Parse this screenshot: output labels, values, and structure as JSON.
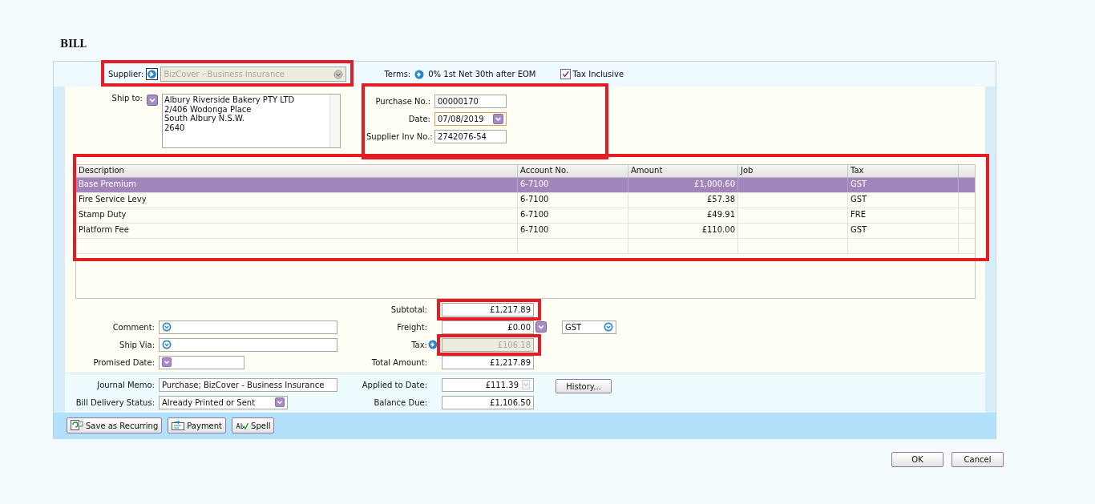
{
  "title": "BILL",
  "supplier": {
    "label": "Supplier:",
    "value": "BizCover - Business Insurance",
    "disabled": true,
    "highlighted": true
  },
  "terms": {
    "label": "Terms:",
    "value": "0% 1st Net 30th after EOM"
  },
  "tax_inclusive": {
    "label": "Tax Inclusive",
    "checked": true
  },
  "ship_to": {
    "label": "Ship to:",
    "lines": [
      "Albury Riverside Bakery PTY LTD",
      "2/406 Wodonga Place",
      "South Albury N.S.W.",
      "2640"
    ]
  },
  "header_fields": {
    "highlighted": true,
    "fields": [
      {
        "label": "Purchase No.:",
        "value": "00000170",
        "kind": "text"
      },
      {
        "label": "Date:",
        "value": "07/08/2019",
        "kind": "date"
      },
      {
        "label": "Supplier Inv No.:",
        "value": "2742076-54",
        "kind": "text"
      }
    ]
  },
  "table": {
    "highlighted": true,
    "columns": [
      "Description",
      "Account No.",
      "Amount",
      "Job",
      "Tax"
    ],
    "rows": [
      {
        "cells": [
          "Base Premium",
          "6-7100",
          "£1,000.60",
          "",
          "GST"
        ],
        "selected": true
      },
      {
        "cells": [
          "Fire Service Levy",
          "6-7100",
          "£57.38",
          "",
          "GST"
        ],
        "selected": false
      },
      {
        "cells": [
          "Stamp Duty",
          "6-7100",
          "£49.91",
          "",
          "FRE"
        ],
        "selected": false
      },
      {
        "cells": [
          "Platform Fee",
          "6-7100",
          "£110.00",
          "",
          "GST"
        ],
        "selected": false
      }
    ]
  },
  "left_fields": [
    {
      "label": "Comment:",
      "kind": "combo"
    },
    {
      "label": "Ship Via:",
      "kind": "combo"
    },
    {
      "label": "Promised Date:",
      "kind": "date"
    }
  ],
  "totals": [
    {
      "label": "Subtotal:",
      "value": "£1,217.89",
      "kind": "plain",
      "disabled": false,
      "highlighted": true
    },
    {
      "label": "Freight:",
      "value": "£0.00",
      "kind": "dropdown",
      "disabled": false,
      "highlighted": false
    },
    {
      "label": "Tax:",
      "value": "£106.18",
      "kind": "link",
      "disabled": true,
      "highlighted": true
    },
    {
      "label": "Total Amount:",
      "value": "£1,217.89",
      "kind": "plain",
      "disabled": false,
      "highlighted": false
    }
  ],
  "freight_tax_code": {
    "value": "GST"
  },
  "memo_fields": [
    {
      "label": "Journal Memo:",
      "value": "Purchase; BizCover - Business Insurance",
      "kind": "text"
    },
    {
      "label": "Bill Delivery Status:",
      "value": "Already Printed or Sent",
      "kind": "dropdown"
    }
  ],
  "payment_fields": [
    {
      "label": "Applied to Date:",
      "value": "£111.39",
      "kind": "dropdown"
    },
    {
      "label": "Balance Due:",
      "value": "£1,106.50",
      "kind": "plain"
    }
  ],
  "history_button": "History...",
  "action_buttons": [
    {
      "label": "Save as Recurring",
      "kind": "recurring"
    },
    {
      "label": "Payment",
      "kind": "payment"
    },
    {
      "label": "Spell",
      "kind": "spell"
    }
  ],
  "dialog_buttons": [
    "OK",
    "Cancel"
  ]
}
